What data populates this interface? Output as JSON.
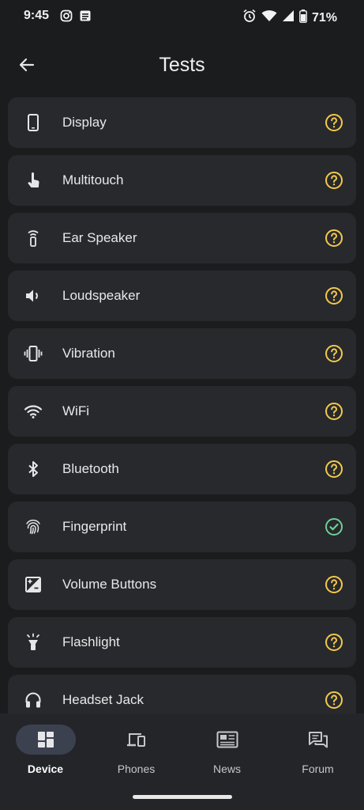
{
  "status_bar": {
    "time": "9:45",
    "battery": "71%"
  },
  "header": {
    "title": "Tests"
  },
  "tests": [
    {
      "label": "Display",
      "icon": "phone-icon",
      "status": "unknown"
    },
    {
      "label": "Multitouch",
      "icon": "touch-icon",
      "status": "unknown"
    },
    {
      "label": "Ear Speaker",
      "icon": "ear-speaker-icon",
      "status": "unknown"
    },
    {
      "label": "Loudspeaker",
      "icon": "speaker-icon",
      "status": "unknown"
    },
    {
      "label": "Vibration",
      "icon": "vibration-icon",
      "status": "unknown"
    },
    {
      "label": "WiFi",
      "icon": "wifi-icon",
      "status": "unknown"
    },
    {
      "label": "Bluetooth",
      "icon": "bluetooth-icon",
      "status": "unknown"
    },
    {
      "label": "Fingerprint",
      "icon": "fingerprint-icon",
      "status": "passed"
    },
    {
      "label": "Volume Buttons",
      "icon": "exposure-icon",
      "status": "unknown"
    },
    {
      "label": "Flashlight",
      "icon": "flashlight-icon",
      "status": "unknown"
    },
    {
      "label": "Headset Jack",
      "icon": "headset-icon",
      "status": "unknown"
    }
  ],
  "bottom_nav": [
    {
      "label": "Device",
      "icon": "dashboard-icon",
      "active": true
    },
    {
      "label": "Phones",
      "icon": "devices-icon",
      "active": false
    },
    {
      "label": "News",
      "icon": "news-icon",
      "active": false
    },
    {
      "label": "Forum",
      "icon": "forum-icon",
      "active": false
    }
  ],
  "colors": {
    "background": "#1b1c1e",
    "card": "#28292c",
    "unknown_status": "#f2c94c",
    "passed_status": "#6fcf97",
    "nav_background": "#232529",
    "nav_active_pill": "#3c4150"
  }
}
